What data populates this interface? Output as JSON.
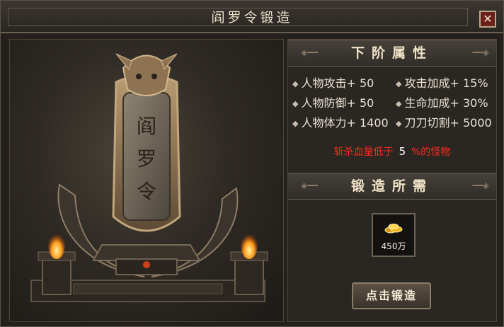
{
  "window": {
    "title": "阎罗令锻造",
    "close_symbol": "✕"
  },
  "artwork": {
    "token_text": "阎罗令",
    "token_chars": [
      "阎",
      "罗",
      "令"
    ]
  },
  "next_tier": {
    "header": "下阶属性",
    "attributes": [
      {
        "label": "人物攻击+ 50"
      },
      {
        "label": "攻击加成+ 15%"
      },
      {
        "label": "人物防御+ 50"
      },
      {
        "label": "生命加成+ 30%"
      },
      {
        "label": "人物体力+ 1400"
      },
      {
        "label": "刀刀切割+ 5000"
      }
    ],
    "note": {
      "prefix": "斩杀血量低于",
      "value": "5",
      "suffix": "%的怪物"
    }
  },
  "requirements": {
    "header": "锻造所需",
    "item": {
      "icon": "gold-coins-icon",
      "amount": "450万"
    }
  },
  "forge_button": {
    "label": "点击锻造"
  },
  "colors": {
    "note_red": "#ff2b1e",
    "gold": "#f2b21f",
    "frame": "#6b6052"
  }
}
